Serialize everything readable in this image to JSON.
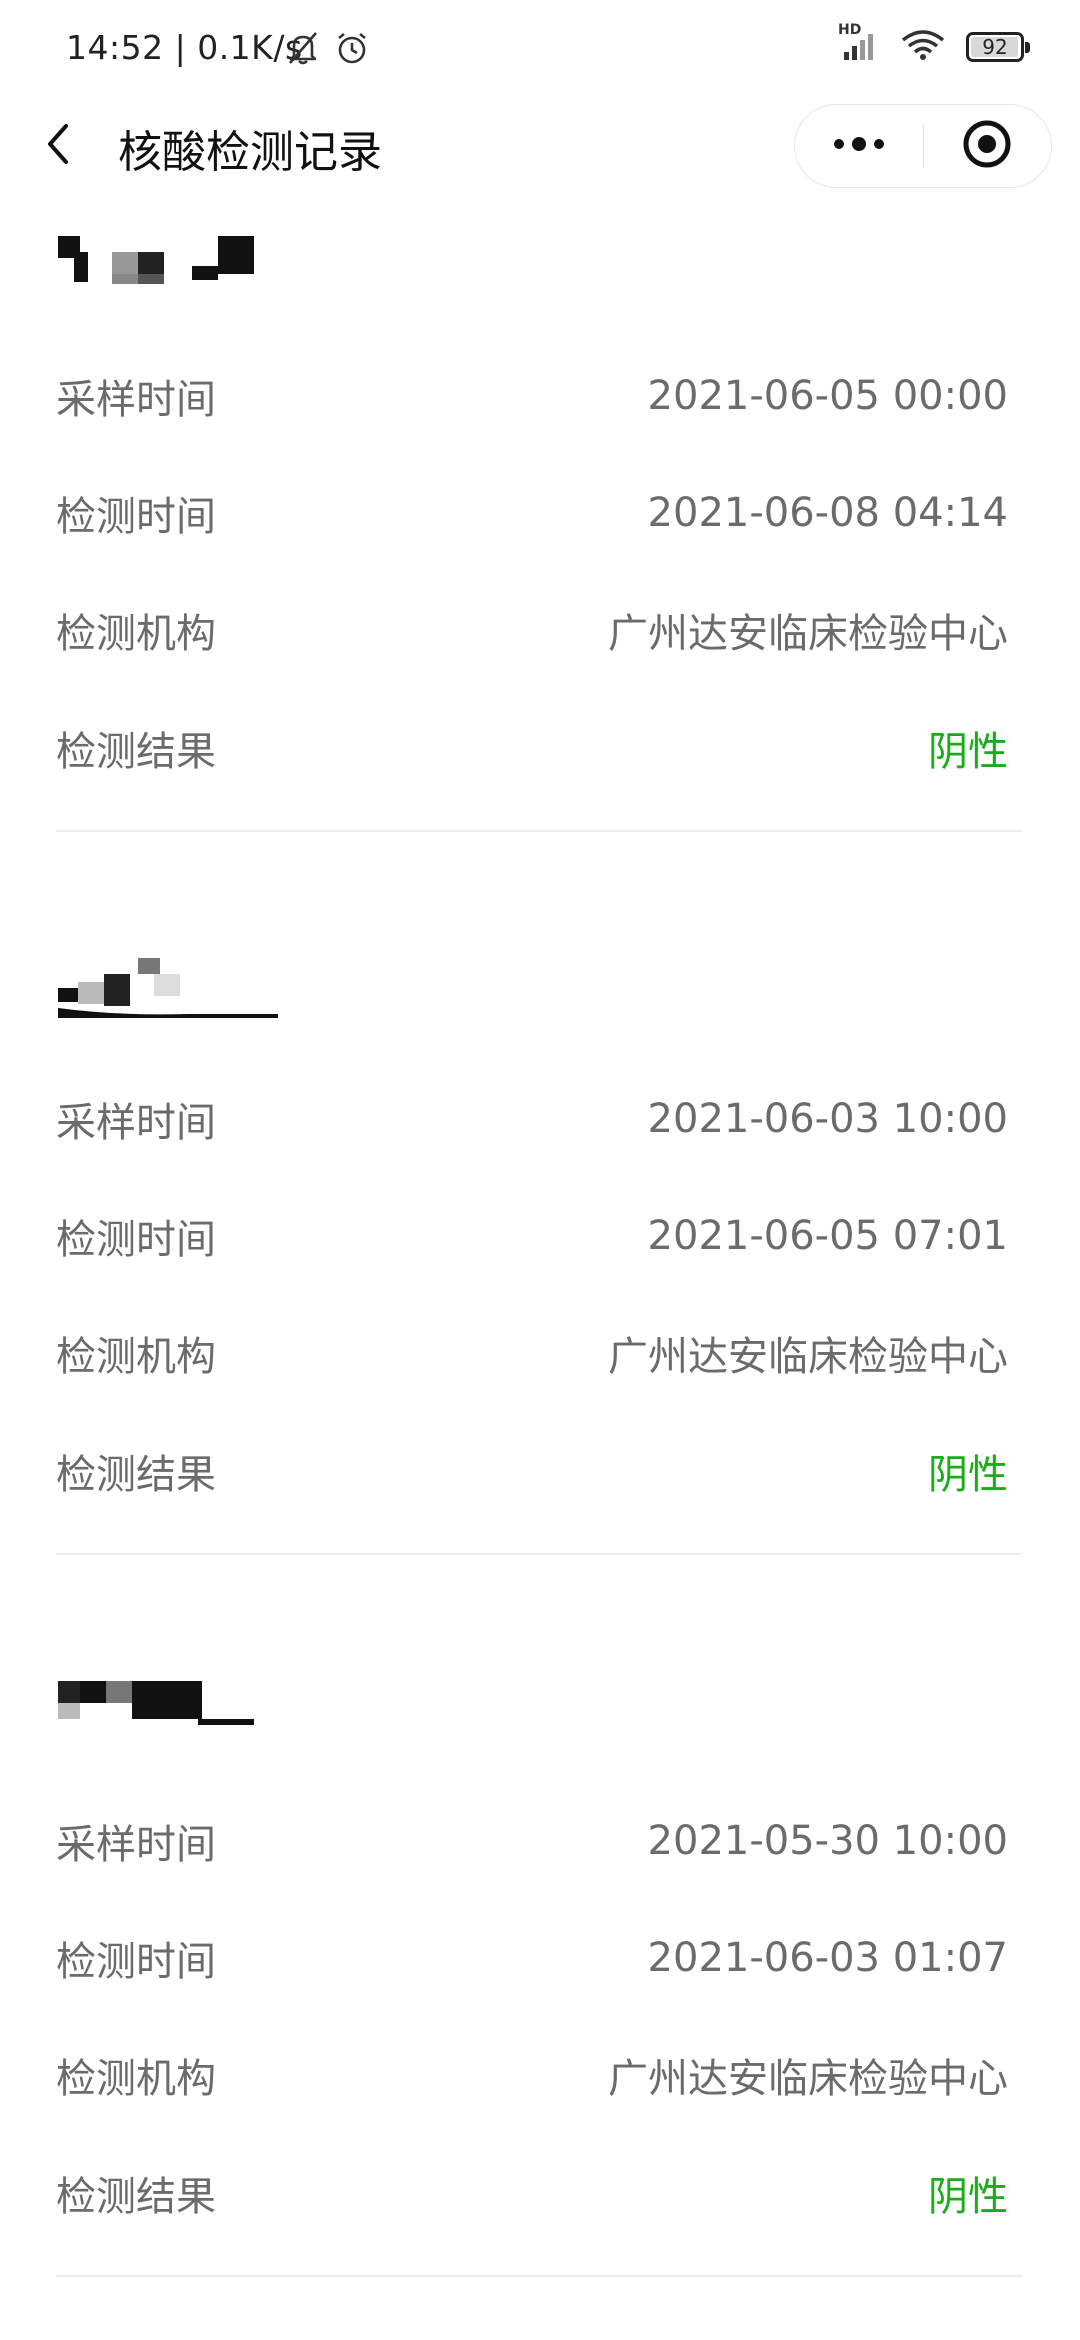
{
  "status_bar": {
    "time_speed": "14:52 | 0.1K/s",
    "network_badge": "HD",
    "battery": "92",
    "icons": [
      "bell-off-icon",
      "alarm-icon",
      "signal-icon",
      "wifi-icon",
      "battery-icon"
    ]
  },
  "nav": {
    "title": "核酸检测记录",
    "back_icon": "chevron-left-icon",
    "more_icon": "more-dots-icon",
    "close_icon": "target-close-icon"
  },
  "colors": {
    "label": "#6b6b6b",
    "negative_result": "#19ad19",
    "divider": "#ededed"
  },
  "records": [
    {
      "name_redacted": true,
      "rows": [
        {
          "label": "采样时间",
          "value": "2021-06-05 00:00"
        },
        {
          "label": "检测时间",
          "value": "2021-06-08 04:14"
        },
        {
          "label": "检测机构",
          "value": "广州达安临床检验中心"
        },
        {
          "label": "检测结果",
          "value": "阴性"
        }
      ]
    },
    {
      "name_redacted": true,
      "rows": [
        {
          "label": "采样时间",
          "value": "2021-06-03 10:00"
        },
        {
          "label": "检测时间",
          "value": "2021-06-05 07:01"
        },
        {
          "label": "检测机构",
          "value": "广州达安临床检验中心"
        },
        {
          "label": "检测结果",
          "value": "阴性"
        }
      ]
    },
    {
      "name_redacted": true,
      "rows": [
        {
          "label": "采样时间",
          "value": "2021-05-30 10:00"
        },
        {
          "label": "检测时间",
          "value": "2021-06-03 01:07"
        },
        {
          "label": "检测机构",
          "value": "广州达安临床检验中心"
        },
        {
          "label": "检测结果",
          "value": "阴性"
        }
      ]
    }
  ]
}
